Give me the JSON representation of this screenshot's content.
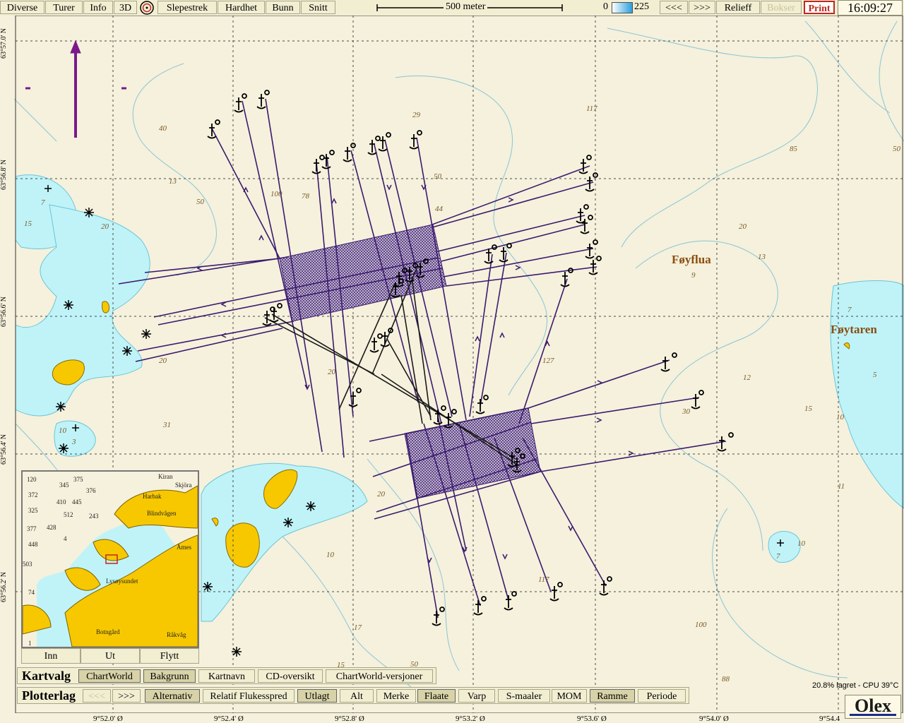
{
  "toolbar": {
    "items": [
      "Diverse",
      "Turer",
      "Info",
      "3D",
      "Slepestrek",
      "Hardhet",
      "Bunn",
      "Snitt"
    ],
    "scale_label": "500 meter",
    "depth_min": "0",
    "depth_max": "225",
    "prev": "<<<",
    "next": ">>>",
    "relief": "Relieff",
    "boxes": "Bokser",
    "print": "Print",
    "clock": "16:09:27"
  },
  "map": {
    "lat_labels": [
      "63°57.0' N",
      "63°56.8' N",
      "63°56.6' N",
      "63°56.4' N",
      "63°56.2' N"
    ],
    "lon_labels": [
      "9°52.0' Ø",
      "9°52.4' Ø",
      "9°52.8' Ø",
      "9°53.2' Ø",
      "9°53.6' Ø",
      "9°54.0' Ø",
      "9°54.4"
    ],
    "places": [
      "Føyflua",
      "Føytaren"
    ],
    "depths": [
      "29",
      "117",
      "85",
      "50",
      "40",
      "13",
      "100",
      "78",
      "50",
      "44",
      "50",
      "20",
      "13",
      "15",
      "20",
      "9",
      "7",
      "5",
      "12",
      "15",
      "10",
      "11",
      "10",
      "7",
      "30",
      "127",
      "117",
      "100",
      "88",
      "17",
      "15",
      "50",
      "20",
      "20",
      "10",
      "31",
      "10",
      "3",
      "20",
      "7"
    ],
    "colors": {
      "sea": "#f5f1dc",
      "shallow": "#bff3f8",
      "land": "#f7c800",
      "track": "#3c1a6e",
      "grid": "#4a4a4a",
      "contour": "#8ac4d8"
    }
  },
  "inset": {
    "labels": [
      "120",
      "345",
      "375",
      "Kiran",
      "Skjöra",
      "376",
      "372",
      "410",
      "445",
      "Harbak",
      "325",
      "512",
      "243",
      "Blindvågen",
      "377",
      "428",
      "448",
      "4",
      "Åmes",
      "503",
      "Lysøysundet",
      "74",
      "Botngård",
      "Råkvåg",
      "1"
    ],
    "buttons": {
      "in": "Inn",
      "out": "Ut",
      "move": "Flytt"
    }
  },
  "kartvalg": {
    "title": "Kartvalg",
    "buttons": [
      "ChartWorld",
      "Bakgrunn",
      "Kartnavn",
      "CD-oversikt",
      "ChartWorld-versjoner"
    ]
  },
  "plotterlag": {
    "title": "Plotterlag",
    "buttons": [
      "<<<",
      ">>>",
      "Alternativ",
      "Relatif Flukesspred",
      "Utlagt",
      "Alt",
      "Merke",
      "Flaate",
      "Varp",
      "S-maaler",
      "MOM",
      "Ramme",
      "Periode"
    ]
  },
  "status": "20.8% lagret - CPU 39°C",
  "logo": "Olex"
}
